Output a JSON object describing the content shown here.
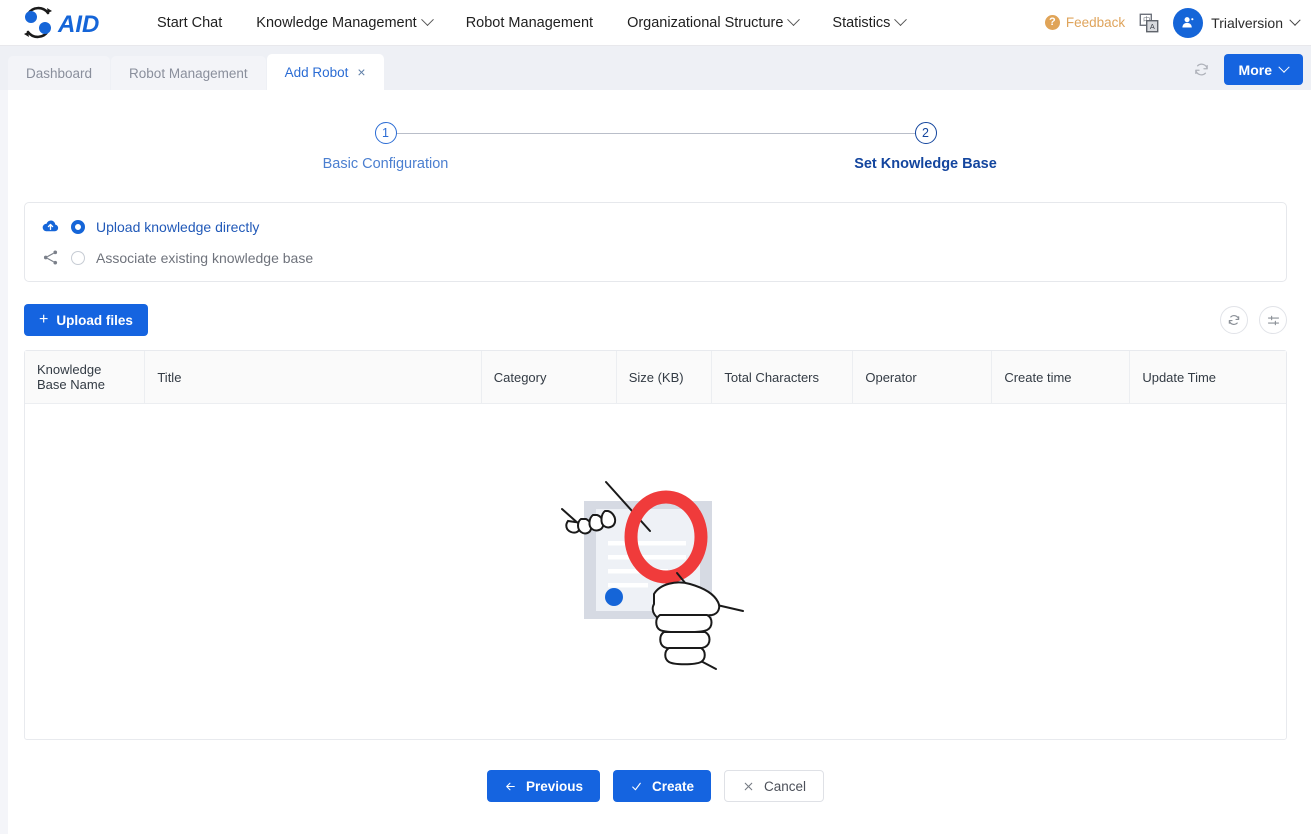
{
  "header": {
    "logo_text": "AID",
    "nav": [
      {
        "label": "Start Chat",
        "has_caret": false
      },
      {
        "label": "Knowledge Management",
        "has_caret": true
      },
      {
        "label": "Robot Management",
        "has_caret": false
      },
      {
        "label": "Organizational Structure",
        "has_caret": true
      },
      {
        "label": "Statistics",
        "has_caret": true
      }
    ],
    "feedback_label": "Feedback",
    "feedback_icon": "question-circle-icon",
    "language_icon": "translate-icon",
    "avatar_icon": "user-icon",
    "username": "Trialversion",
    "accent_color": "#1565d8",
    "feedback_color": "#dfa45c"
  },
  "tabbar": {
    "tabs": [
      {
        "label": "Dashboard",
        "active": false,
        "closable": false
      },
      {
        "label": "Robot Management",
        "active": false,
        "closable": false
      },
      {
        "label": "Add Robot",
        "active": true,
        "closable": true
      }
    ],
    "close_glyph": "×",
    "refresh_icon": "refresh-icon",
    "more_label": "More"
  },
  "stepper": {
    "steps": [
      {
        "number": "1",
        "label": "Basic Configuration",
        "active": false
      },
      {
        "number": "2",
        "label": "Set Knowledge Base",
        "active": true
      }
    ]
  },
  "source": {
    "options": [
      {
        "label": "Upload knowledge directly",
        "icon": "cloud-upload-icon",
        "selected": true
      },
      {
        "label": "Associate existing knowledge base",
        "icon": "share-nodes-icon",
        "selected": false
      }
    ]
  },
  "toolbar": {
    "upload_label": "Upload files",
    "plus_glyph": "+",
    "refresh_icon": "refresh-icon",
    "settings_icon": "column-settings-icon"
  },
  "table": {
    "columns": [
      "Knowledge Base Name",
      "Title",
      "Category",
      "Size (KB)",
      "Total Characters",
      "Operator",
      "Create time",
      "Update Time"
    ],
    "rows": [],
    "empty_illustration": "magnifier-document-illustration"
  },
  "footer": {
    "buttons": [
      {
        "label": "Previous",
        "icon": "arrow-left-icon",
        "style": "primary"
      },
      {
        "label": "Create",
        "icon": "check-icon",
        "style": "primary"
      },
      {
        "label": "Cancel",
        "icon": "close-icon",
        "style": "ghost"
      }
    ]
  }
}
